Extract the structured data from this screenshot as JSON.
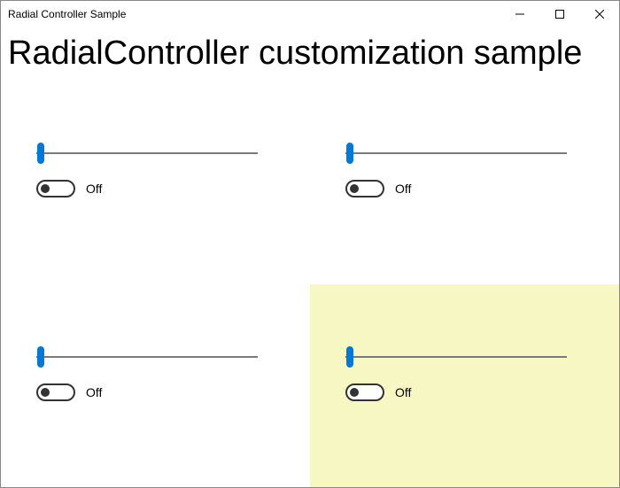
{
  "window": {
    "title": "Radial Controller Sample"
  },
  "page": {
    "heading": "RadialController customization sample"
  },
  "panels": [
    {
      "slider_value": 0,
      "toggle_state": "Off",
      "highlighted": false
    },
    {
      "slider_value": 0,
      "toggle_state": "Off",
      "highlighted": false
    },
    {
      "slider_value": 0,
      "toggle_state": "Off",
      "highlighted": false
    },
    {
      "slider_value": 0,
      "toggle_state": "Off",
      "highlighted": true
    }
  ],
  "colors": {
    "accent": "#0078d7",
    "highlight_bg": "#f7f7c4"
  }
}
